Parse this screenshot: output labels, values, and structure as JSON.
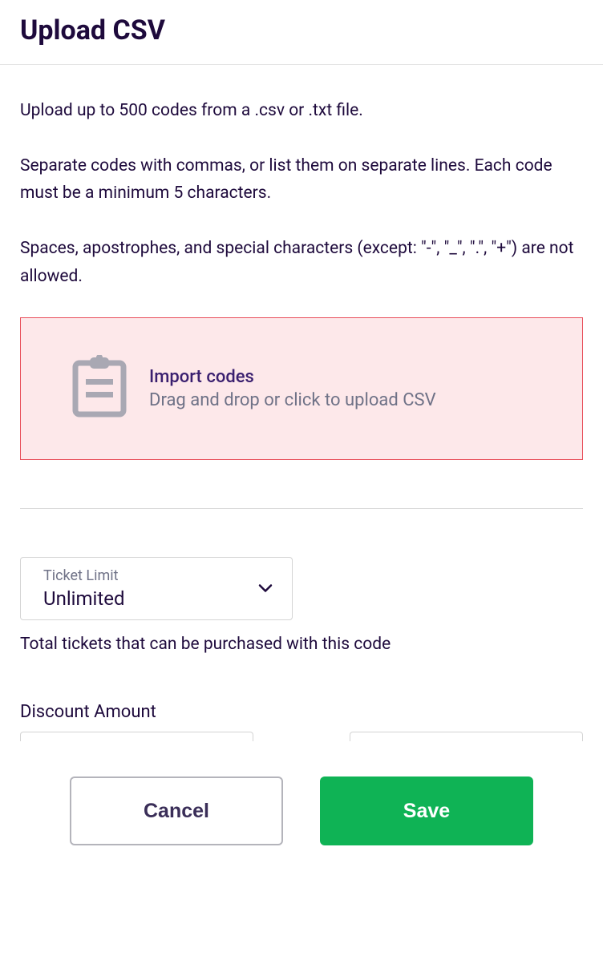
{
  "header": {
    "title": "Upload CSV"
  },
  "instructions": {
    "line1": "Upload up to 500 codes from a .csv or .txt file.",
    "line2": "Separate codes with commas, or list them on separate lines. Each code must be a minimum 5 characters.",
    "line3": "Spaces, apostrophes, and special characters (except: \"-\", \"_\", \".\", \"+\") are not allowed."
  },
  "dropzone": {
    "title": "Import codes",
    "subtitle": "Drag and drop or click to upload CSV"
  },
  "ticketLimit": {
    "label": "Ticket Limit",
    "value": "Unlimited",
    "help": "Total tickets that can be purchased with this code"
  },
  "discount": {
    "label": "Discount Amount"
  },
  "footer": {
    "cancel": "Cancel",
    "save": "Save"
  }
}
